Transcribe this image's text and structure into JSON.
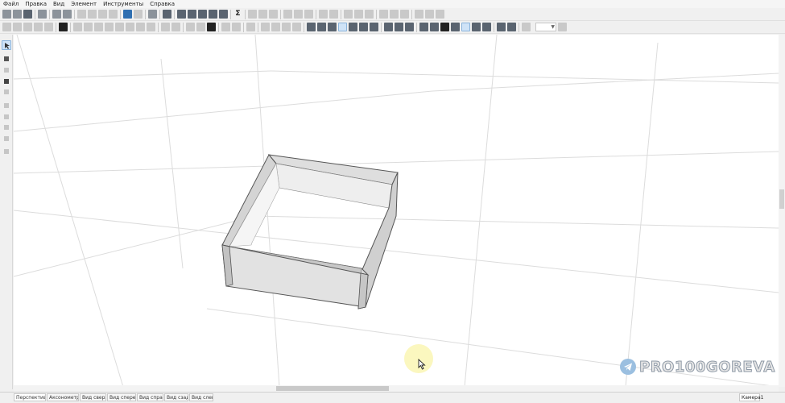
{
  "menu": {
    "items": [
      "Файл",
      "Правка",
      "Вид",
      "Элемент",
      "Инструменты",
      "Справка"
    ]
  },
  "toolbar": {
    "sigma": "Σ"
  },
  "view_tabs": [
    "Перспектива",
    "Аксонометрия",
    "Вид сверху",
    "Вид спереди",
    "Вид справа",
    "Вид сзади",
    "Вид слева"
  ],
  "camera_tab": "Камера1",
  "watermark": {
    "text": "PRO100GOREVA",
    "icon": "telegram-icon"
  },
  "colors": {
    "toolbar_bg": "#f0f0f0",
    "viewport_bg": "#ffffff",
    "grid_line": "#d9d9d9",
    "box_face": "#e4e4e4",
    "box_edge": "#555555",
    "active_tool": "#cfe3f7",
    "cursor_highlight": "#faf4aa"
  }
}
